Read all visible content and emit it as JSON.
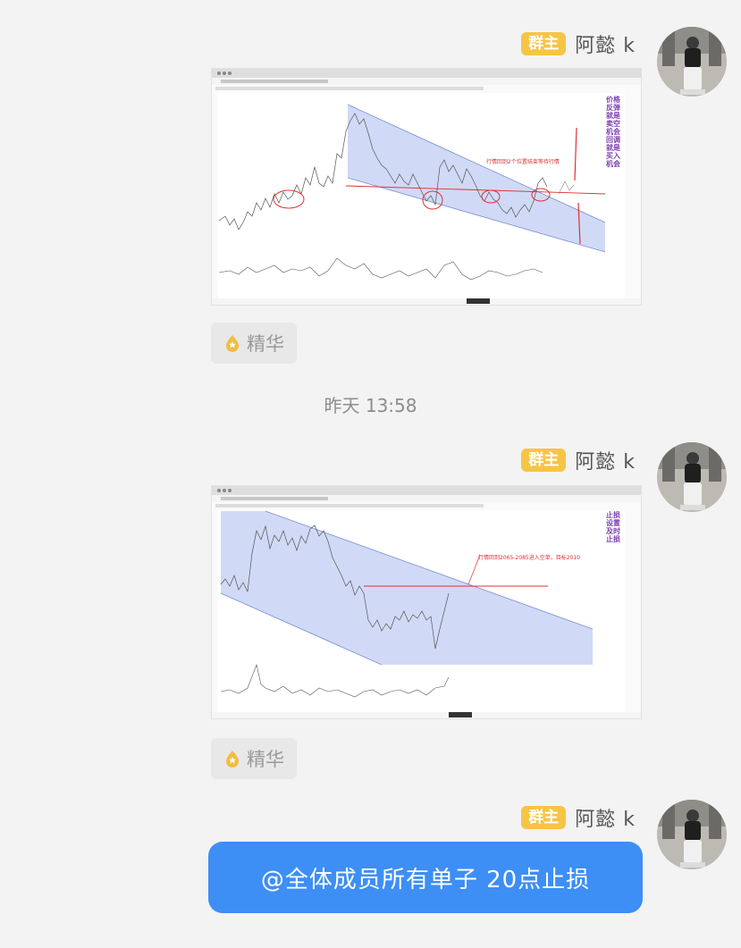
{
  "messages": [
    {
      "role_badge": "群主",
      "sender": "阿懿 k",
      "type": "image",
      "chart_annotation": "行情回到2个位置结束等待行情",
      "side_text": "价格反弹就是卖空机会 回调就是买入机会",
      "essence_label": "精华"
    },
    {
      "role_badge": "群主",
      "sender": "阿懿 k",
      "type": "image",
      "chart_annotation": "行情回到2065-2085进入空单，目标2010",
      "side_text": "止损设置 及时止损",
      "essence_label": "精华"
    },
    {
      "role_badge": "群主",
      "sender": "阿懿 k",
      "type": "text",
      "text": "@全体成员所有单子 20点止损"
    }
  ],
  "timestamp": "昨天 13:58",
  "colors": {
    "bubble": "#3d8ef5",
    "badge": "#f6c545",
    "channel_fill": "#c8d4f5",
    "annotation": "#e03030",
    "side_text": "#7a3fb0"
  }
}
